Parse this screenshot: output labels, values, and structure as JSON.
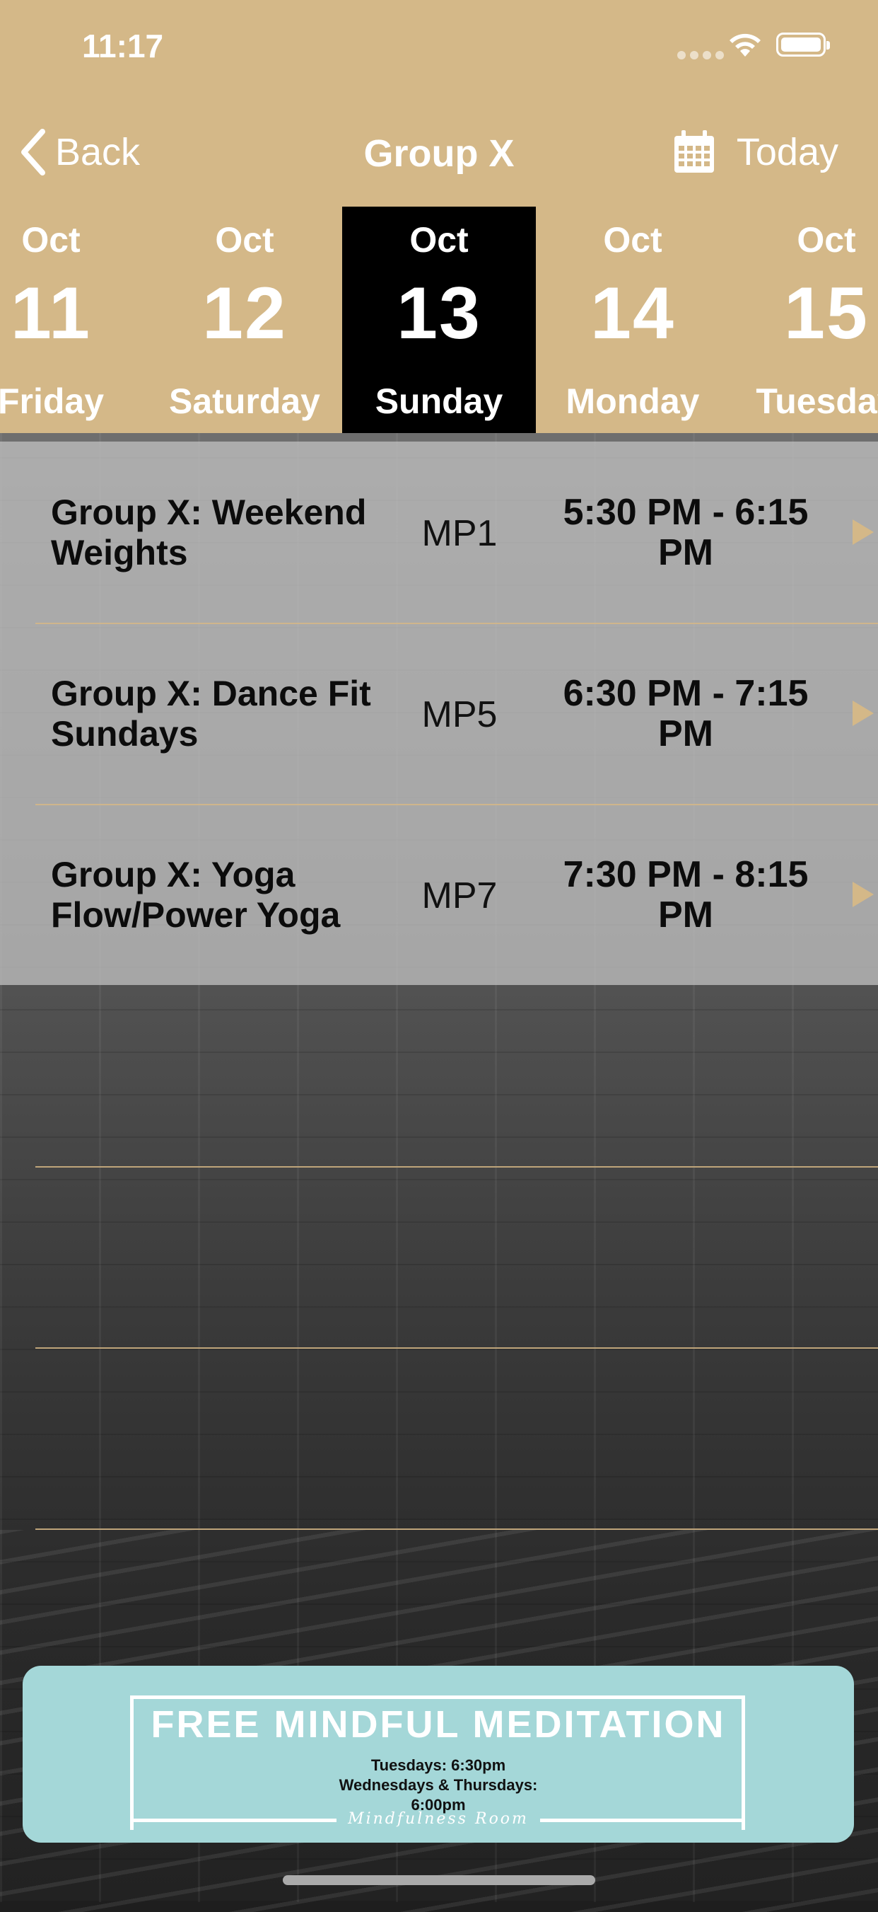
{
  "status_bar": {
    "time": "11:17"
  },
  "nav": {
    "back_label": "Back",
    "title": "Group X",
    "today_label": "Today"
  },
  "dates": [
    {
      "month": "Oct",
      "day": "11",
      "weekday": "Friday",
      "selected": false
    },
    {
      "month": "Oct",
      "day": "12",
      "weekday": "Saturday",
      "selected": false
    },
    {
      "month": "Oct",
      "day": "13",
      "weekday": "Sunday",
      "selected": true
    },
    {
      "month": "Oct",
      "day": "14",
      "weekday": "Monday",
      "selected": false
    },
    {
      "month": "Oct",
      "day": "15",
      "weekday": "Tuesday",
      "selected": false
    }
  ],
  "events": [
    {
      "name": "Group X: Weekend Weights",
      "room": "MP1",
      "time": "5:30 PM - 6:15 PM"
    },
    {
      "name": "Group X: Dance Fit Sundays",
      "room": "MP5",
      "time": "6:30 PM - 7:15 PM"
    },
    {
      "name": "Group X: Yoga Flow/Power Yoga",
      "room": "MP7",
      "time": "7:30 PM - 8:15 PM"
    }
  ],
  "banner": {
    "title": "FREE MINDFUL MEDITATION",
    "line1": "Tuesdays: 6:30pm",
    "line2": "Wednesdays & Thursdays:",
    "line3": "6:00pm",
    "room": "Mindfulness Room"
  },
  "colors": {
    "gold": "#d4b888",
    "selected": "#000000",
    "banner": "#a4d7d8"
  }
}
